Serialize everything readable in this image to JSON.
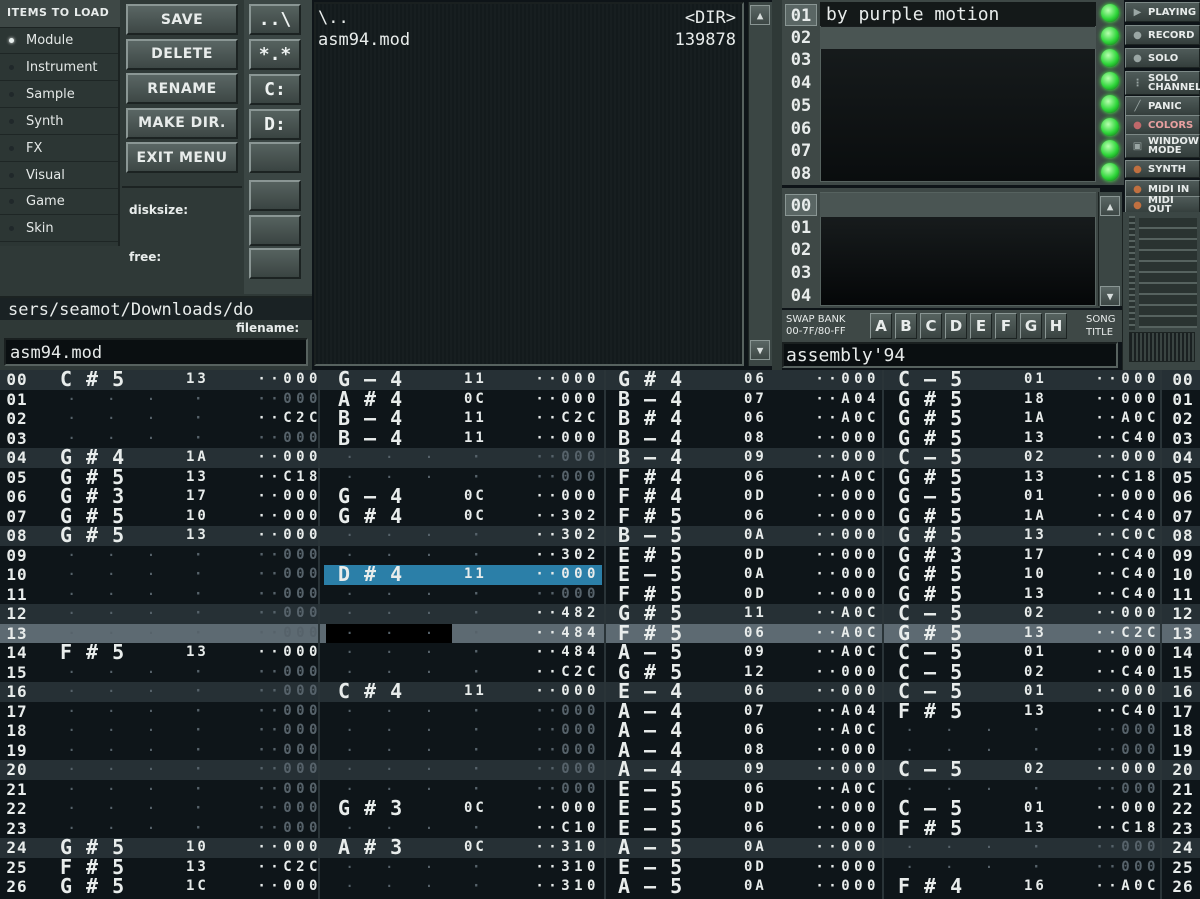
{
  "disk_op": {
    "header": "ITEMS TO LOAD",
    "items": [
      "Module",
      "Instrument",
      "Sample",
      "Synth",
      "FX",
      "Visual",
      "Game",
      "Skin"
    ],
    "selected_index": 0,
    "buttons": [
      "SAVE",
      "DELETE",
      "RENAME",
      "MAKE DIR.",
      "EXIT MENU"
    ],
    "quick_buttons": [
      "..\\",
      "*.*",
      "C:",
      "D:"
    ],
    "disksize_label": "disksize:",
    "free_label": "free:",
    "path": "sers/seamot/Downloads/do",
    "filename_label": "filename:",
    "filename": "asm94.mod"
  },
  "file_list": [
    {
      "name": "\\..",
      "size": "<DIR>"
    },
    {
      "name": "asm94.mod",
      "size": "139878"
    }
  ],
  "instruments": {
    "numbers": [
      "01",
      "02",
      "03",
      "04",
      "05",
      "06",
      "07",
      "08"
    ],
    "names": [
      "by purple motion",
      "",
      "",
      "",
      "",
      "",
      "",
      ""
    ]
  },
  "samples": {
    "numbers": [
      "00",
      "01",
      "02",
      "03",
      "04"
    ]
  },
  "swap_bank": {
    "label1": "SWAP BANK",
    "label2": "00-7F/80-FF",
    "letters": [
      "A",
      "B",
      "C",
      "D",
      "E",
      "F",
      "G",
      "H"
    ]
  },
  "song_title_label": [
    "SONG",
    "TITLE"
  ],
  "song_title": "assembly'94",
  "right_buttons": [
    {
      "label": "PLAYING",
      "icon": "play-icon",
      "glyph": "▶"
    },
    {
      "label": "RECORD",
      "icon": "record-icon",
      "glyph": "●"
    },
    {
      "label": "SOLO",
      "icon": "solo-icon",
      "glyph": "●"
    },
    {
      "label": "SOLO CHANNEL",
      "icon": "solo-channel-icon",
      "glyph": "⋮"
    },
    {
      "label": "PANIC",
      "icon": "panic-icon",
      "glyph": "╱"
    },
    {
      "label": "COLORS",
      "icon": "colors-icon",
      "glyph": "●"
    },
    {
      "label": "WINDOW MODE",
      "icon": "window-icon",
      "glyph": "▣"
    },
    {
      "label": "SYNTH",
      "icon": "synth-icon",
      "glyph": "●"
    },
    {
      "label": "MIDI IN",
      "icon": "midi-in-icon",
      "glyph": "●"
    },
    {
      "label": "MIDI OUT",
      "icon": "midi-out-icon",
      "glyph": "●"
    }
  ],
  "colors": {
    "cursor": "#2b7fa8",
    "led": "#2fd63a",
    "colors_button": "#c0686a"
  },
  "pattern": {
    "current_row": 13,
    "cursor_channel": 1,
    "rows": [
      [
        "00",
        "C#5",
        "13",
        "000",
        "G-4",
        "11",
        "000",
        "G#4",
        "06",
        "000",
        "C-5",
        "01",
        "000"
      ],
      [
        "01",
        "",
        "",
        "000",
        "A#4",
        "0C",
        "000",
        "B-4",
        "07",
        "A04",
        "G#5",
        "18",
        "000"
      ],
      [
        "02",
        "",
        "",
        "C2C",
        "B-4",
        "11",
        "C2C",
        "B#4",
        "06",
        "A0C",
        "G#5",
        "1A",
        "A0C"
      ],
      [
        "03",
        "",
        "",
        "000",
        "B-4",
        "11",
        "000",
        "B-4",
        "08",
        "000",
        "G#5",
        "13",
        "C40"
      ],
      [
        "04",
        "G#4",
        "1A",
        "000",
        "",
        "",
        "000",
        "B-4",
        "09",
        "000",
        "C-5",
        "02",
        "000"
      ],
      [
        "05",
        "G#5",
        "13",
        "C18",
        "",
        "",
        "000",
        "F#4",
        "06",
        "A0C",
        "G#5",
        "13",
        "C18"
      ],
      [
        "06",
        "G#3",
        "17",
        "000",
        "G-4",
        "0C",
        "000",
        "F#4",
        "0D",
        "000",
        "G-5",
        "01",
        "000"
      ],
      [
        "07",
        "G#5",
        "10",
        "000",
        "G#4",
        "0C",
        "302",
        "F#5",
        "06",
        "000",
        "G#5",
        "1A",
        "C40"
      ],
      [
        "08",
        "G#5",
        "13",
        "000",
        "",
        "",
        "302",
        "B-5",
        "0A",
        "000",
        "G#5",
        "13",
        "C0C"
      ],
      [
        "09",
        "",
        "",
        "000",
        "",
        "",
        "302",
        "E#5",
        "0D",
        "000",
        "G#3",
        "17",
        "C40"
      ],
      [
        "10",
        "",
        "",
        "000",
        "D#4",
        "11",
        "000",
        "E-5",
        "0A",
        "000",
        "G#5",
        "10",
        "C40"
      ],
      [
        "11",
        "",
        "",
        "000",
        "",
        "",
        "000",
        "F#5",
        "0D",
        "000",
        "G#5",
        "13",
        "C40"
      ],
      [
        "12",
        "",
        "",
        "000",
        "",
        "",
        "482",
        "G#5",
        "11",
        "A0C",
        "C-5",
        "02",
        "000"
      ],
      [
        "13",
        "",
        "",
        "000",
        "",
        "",
        "484",
        "F#5",
        "06",
        "A0C",
        "G#5",
        "13",
        "C2C"
      ],
      [
        "14",
        "F#5",
        "13",
        "000",
        "",
        "",
        "484",
        "A-5",
        "09",
        "A0C",
        "C-5",
        "01",
        "000"
      ],
      [
        "15",
        "",
        "",
        "000",
        "",
        "",
        "C2C",
        "G#5",
        "12",
        "000",
        "C-5",
        "02",
        "C40"
      ],
      [
        "16",
        "",
        "",
        "000",
        "C#4",
        "11",
        "000",
        "E-4",
        "06",
        "000",
        "C-5",
        "01",
        "000"
      ],
      [
        "17",
        "",
        "",
        "000",
        "",
        "",
        "000",
        "A-4",
        "07",
        "A04",
        "F#5",
        "13",
        "C40"
      ],
      [
        "18",
        "",
        "",
        "000",
        "",
        "",
        "000",
        "A-4",
        "06",
        "A0C",
        "",
        "",
        "000"
      ],
      [
        "19",
        "",
        "",
        "000",
        "",
        "",
        "000",
        "A-4",
        "08",
        "000",
        "",
        "",
        "000"
      ],
      [
        "20",
        "",
        "",
        "000",
        "",
        "",
        "000",
        "A-4",
        "09",
        "000",
        "C-5",
        "02",
        "000"
      ],
      [
        "21",
        "",
        "",
        "000",
        "",
        "",
        "000",
        "E-5",
        "06",
        "A0C",
        "",
        "",
        "000"
      ],
      [
        "22",
        "",
        "",
        "000",
        "G#3",
        "0C",
        "000",
        "E-5",
        "0D",
        "000",
        "C-5",
        "01",
        "000"
      ],
      [
        "23",
        "",
        "",
        "000",
        "",
        "",
        "C10",
        "E-5",
        "06",
        "000",
        "F#5",
        "13",
        "C18"
      ],
      [
        "24",
        "G#5",
        "10",
        "000",
        "A#3",
        "0C",
        "310",
        "A-5",
        "0A",
        "000",
        "",
        "",
        "000"
      ],
      [
        "25",
        "F#5",
        "13",
        "C2C",
        "",
        "",
        "310",
        "E-5",
        "0D",
        "000",
        "",
        "",
        "000"
      ],
      [
        "26",
        "G#5",
        "1C",
        "000",
        "",
        "",
        "310",
        "A-5",
        "0A",
        "000",
        "F#4",
        "16",
        "A0C"
      ]
    ]
  }
}
